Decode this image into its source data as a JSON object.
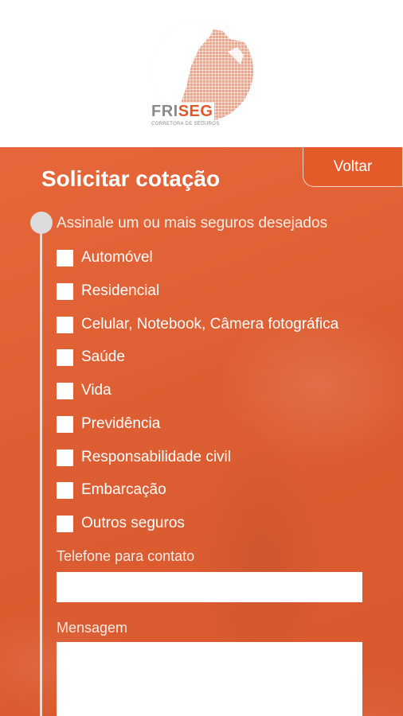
{
  "brand": {
    "name_part1": "FRI",
    "name_part2": "SEG",
    "tagline": "CORRETORA DE SEGUROS",
    "colors": {
      "accent": "#e0582a",
      "gray": "#8a8a8a",
      "panel": "#e0602f"
    }
  },
  "page": {
    "title": "Solicitar cotação",
    "back_label": "Voltar"
  },
  "form": {
    "section_label": "Assinale um ou mais seguros desejados",
    "options": [
      {
        "label": "Automóvel",
        "checked": false
      },
      {
        "label": "Residencial",
        "checked": false
      },
      {
        "label": "Celular, Notebook, Câmera fotográfica",
        "checked": false
      },
      {
        "label": "Saúde",
        "checked": false
      },
      {
        "label": "Vida",
        "checked": false
      },
      {
        "label": "Previdência",
        "checked": false
      },
      {
        "label": "Responsabilidade civil",
        "checked": false
      },
      {
        "label": "Embarcação",
        "checked": false
      },
      {
        "label": "Outros seguros",
        "checked": false
      }
    ],
    "phone": {
      "label": "Telefone para contato",
      "value": ""
    },
    "message": {
      "label": "Mensagem",
      "value": ""
    }
  }
}
